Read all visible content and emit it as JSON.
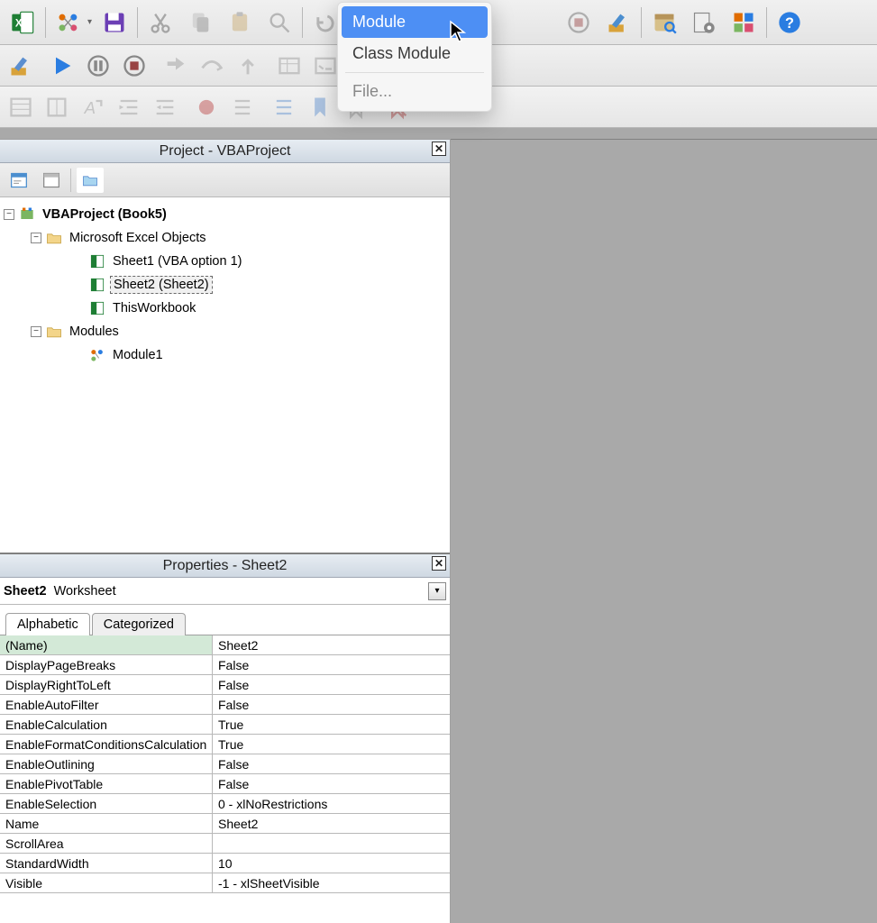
{
  "dropdown": {
    "module": "Module",
    "class_module": "Class Module",
    "file": "File..."
  },
  "project_pane": {
    "title": "Project - VBAProject",
    "root": "VBAProject (Book5)",
    "excel_objects": "Microsoft Excel Objects",
    "sheet1": "Sheet1 (VBA option 1)",
    "sheet2": "Sheet2 (Sheet2)",
    "thisworkbook": "ThisWorkbook",
    "modules": "Modules",
    "module1": "Module1"
  },
  "props_pane": {
    "title": "Properties - Sheet2",
    "object_name": "Sheet2",
    "object_type": "Worksheet",
    "tabs": {
      "alpha": "Alphabetic",
      "cat": "Categorized"
    },
    "rows": [
      {
        "name": "(Name)",
        "value": "Sheet2"
      },
      {
        "name": "DisplayPageBreaks",
        "value": "False"
      },
      {
        "name": "DisplayRightToLeft",
        "value": "False"
      },
      {
        "name": "EnableAutoFilter",
        "value": "False"
      },
      {
        "name": "EnableCalculation",
        "value": "True"
      },
      {
        "name": "EnableFormatConditionsCalculation",
        "value": "True"
      },
      {
        "name": "EnableOutlining",
        "value": "False"
      },
      {
        "name": "EnablePivotTable",
        "value": "False"
      },
      {
        "name": "EnableSelection",
        "value": "0 - xlNoRestrictions"
      },
      {
        "name": "Name",
        "value": "Sheet2"
      },
      {
        "name": "ScrollArea",
        "value": ""
      },
      {
        "name": "StandardWidth",
        "value": "10"
      },
      {
        "name": "Visible",
        "value": "-1 - xlSheetVisible"
      }
    ]
  }
}
